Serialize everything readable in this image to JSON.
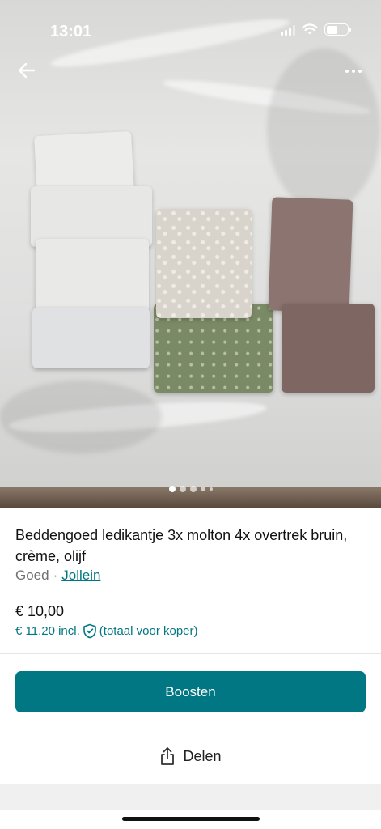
{
  "status_bar": {
    "time": "13:01",
    "icons": [
      "signal-icon",
      "wifi-icon",
      "battery-icon"
    ]
  },
  "nav": {
    "back_icon": "arrow-left-icon",
    "more_icon": "more-horizontal-icon"
  },
  "gallery": {
    "image_count_dots": 5,
    "active_index": 0
  },
  "item": {
    "title": "Beddengoed ledikantje 3x molton 4x overtrek bruin, crème, olijf",
    "condition": "Goed",
    "separator": "·",
    "brand": "Jollein",
    "price": "€ 10,00",
    "price_incl": "€ 11,20 incl.",
    "buyer_total_note": "(totaal voor koper)"
  },
  "actions": {
    "boost_label": "Boosten",
    "share_label": "Delen"
  },
  "colors": {
    "accent": "#007782",
    "text": "#111111",
    "muted": "#707070"
  }
}
